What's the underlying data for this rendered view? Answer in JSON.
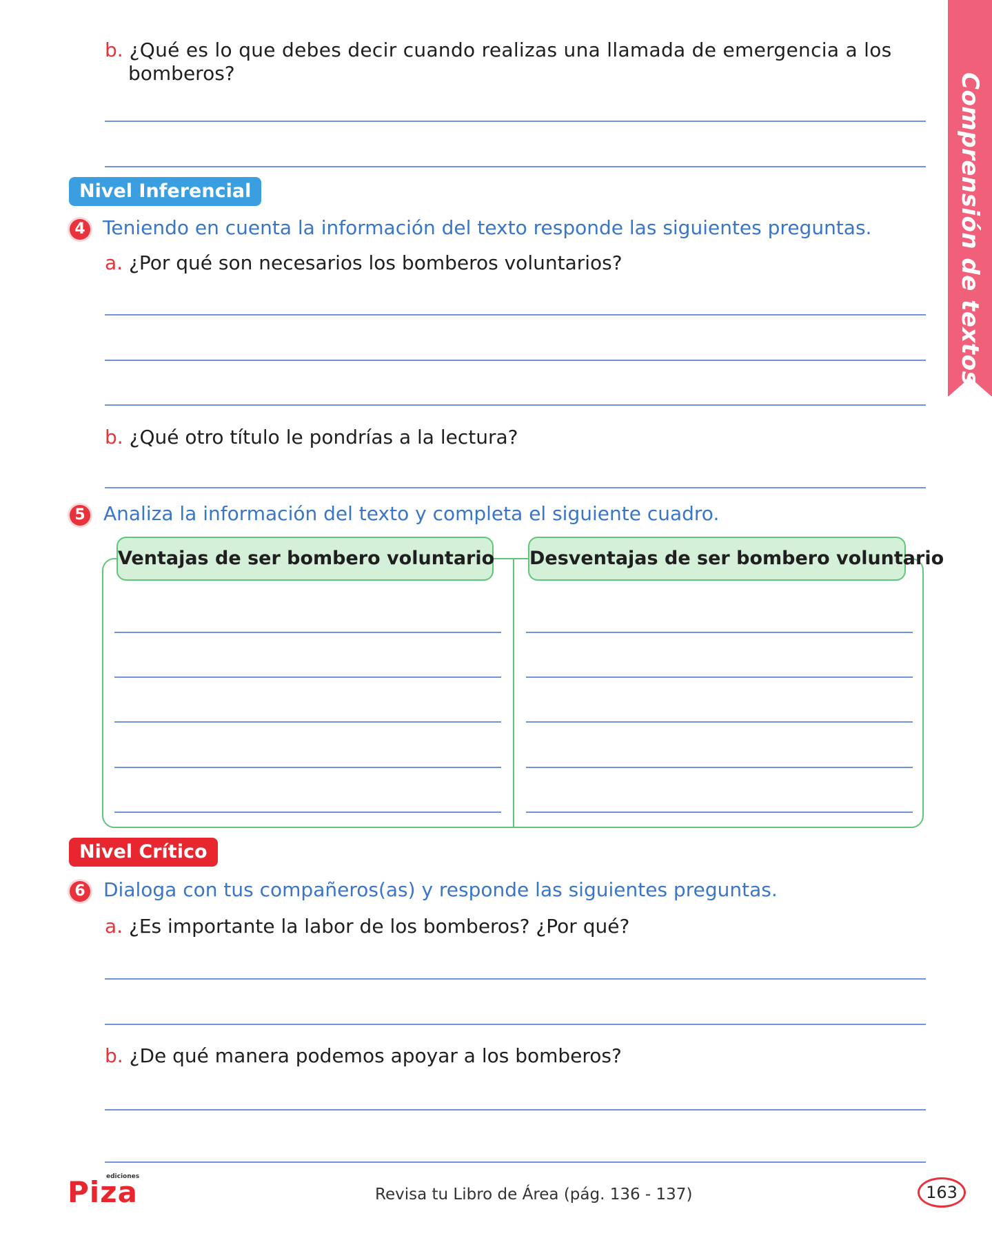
{
  "side_tab": {
    "label": "Comprensión de textos",
    "color": "#f0607a"
  },
  "q3b": {
    "letter": "b.",
    "text_line1": "¿Qué es lo que debes decir cuando realizas una llamada de emergencia a los",
    "text_line2": "bomberos?"
  },
  "nivel_inferencial": {
    "label": "Nivel Inferencial",
    "color": "#3a9ee0"
  },
  "q4": {
    "number": "4",
    "instruction": "Teniendo en cuenta la información del texto responde las siguientes preguntas.",
    "a": {
      "letter": "a.",
      "text": "¿Por qué son necesarios los bomberos voluntarios?"
    },
    "b": {
      "letter": "b.",
      "text": "¿Qué otro título le pondrías a la lectura?"
    }
  },
  "q5": {
    "number": "5",
    "instruction": "Analiza la información del texto y completa el siguiente cuadro.",
    "col1": "Ventajas de ser bombero voluntario",
    "col2": "Desventajas de ser bombero voluntario"
  },
  "nivel_critico": {
    "label": "Nivel Crítico",
    "color": "#e8262f"
  },
  "q6": {
    "number": "6",
    "instruction": "Dialoga con tus compañeros(as) y responde las siguientes preguntas.",
    "a": {
      "letter": "a.",
      "text": "¿Es importante la labor de los bomberos? ¿Por qué?"
    },
    "b": {
      "letter": "b.",
      "text": "¿De qué manera podemos apoyar a los bomberos?"
    }
  },
  "footer": {
    "logo_small": "ediciones",
    "logo_main": "Piza",
    "note": "Revisa tu Libro de Área (pág. 136 - 137)",
    "page": "163"
  }
}
